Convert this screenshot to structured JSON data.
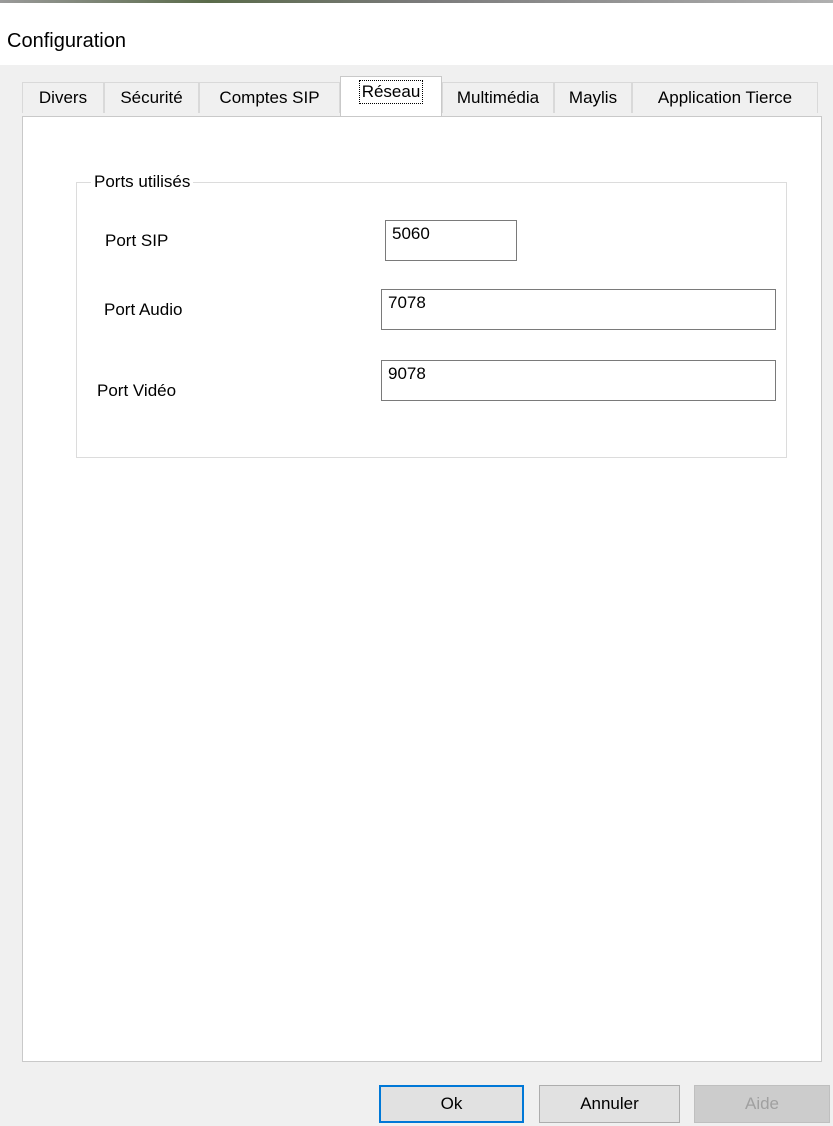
{
  "window": {
    "title": "Configuration"
  },
  "tabs": [
    {
      "label": "Divers",
      "active": false
    },
    {
      "label": "Sécurité",
      "active": false
    },
    {
      "label": "Comptes SIP",
      "active": false
    },
    {
      "label": "Réseau",
      "active": true
    },
    {
      "label": "Multimédia",
      "active": false
    },
    {
      "label": "Maylis",
      "active": false
    },
    {
      "label": "Application Tierce",
      "active": false
    }
  ],
  "group": {
    "title": "Ports utilisés",
    "fields": [
      {
        "label": "Port SIP",
        "value": "5060"
      },
      {
        "label": "Port Audio",
        "value": "7078"
      },
      {
        "label": "Port Vidéo",
        "value": "9078"
      }
    ]
  },
  "buttons": {
    "ok": "Ok",
    "cancel": "Annuler",
    "help": "Aide",
    "help_enabled": false
  },
  "colors": {
    "default_button_border": "#0078d7",
    "window_background": "#f0f0f0",
    "panel_background": "#ffffff"
  }
}
